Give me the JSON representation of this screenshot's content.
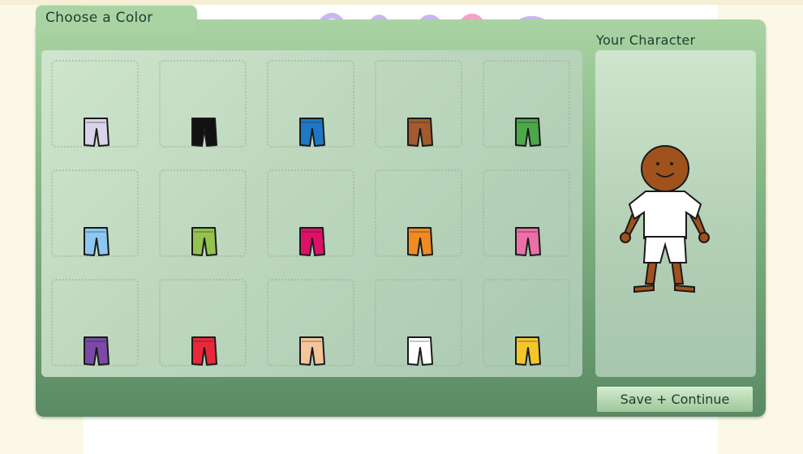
{
  "tab": {
    "label": "Choose a Color"
  },
  "character_panel": {
    "label": "Your Character"
  },
  "buttons": {
    "save_continue": "Save + Continue"
  },
  "swatches": [
    {
      "name": "lavender-gray",
      "color": "#d8d4ea"
    },
    {
      "name": "black",
      "color": "#111111"
    },
    {
      "name": "blue",
      "color": "#1e78c8"
    },
    {
      "name": "brown",
      "color": "#a35a2d"
    },
    {
      "name": "green",
      "color": "#4ba84b"
    },
    {
      "name": "light-blue",
      "color": "#8cc8ef"
    },
    {
      "name": "lime-green",
      "color": "#93c34c"
    },
    {
      "name": "magenta",
      "color": "#e0106a"
    },
    {
      "name": "orange",
      "color": "#f28a22"
    },
    {
      "name": "pink",
      "color": "#ec6fa8"
    },
    {
      "name": "purple",
      "color": "#7a4aa6"
    },
    {
      "name": "red",
      "color": "#e8283a"
    },
    {
      "name": "peach",
      "color": "#f4c49a"
    },
    {
      "name": "white",
      "color": "#ffffff"
    },
    {
      "name": "yellow",
      "color": "#f2c72a"
    }
  ],
  "character": {
    "skin": "#a0521d",
    "shirt": "#ffffff",
    "shorts": "#ffffff"
  }
}
